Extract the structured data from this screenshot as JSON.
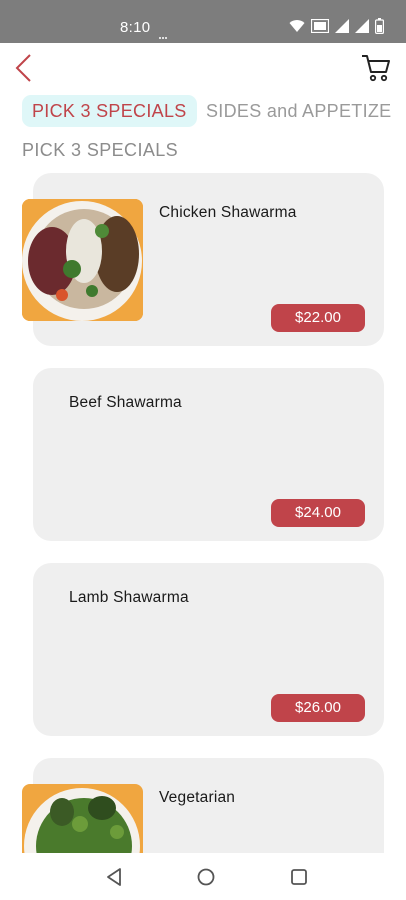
{
  "status_bar": {
    "time": "8:10",
    "icons": [
      "wifi-icon",
      "data-icon",
      "signal-icon",
      "signal-icon",
      "battery-icon"
    ]
  },
  "header": {
    "back_icon": "chevron-left-icon",
    "cart_icon": "cart-icon"
  },
  "tabs": [
    {
      "label": "PICK 3 SPECIALS",
      "active": true
    },
    {
      "label": "SIDES and APPETIZE",
      "active": false
    }
  ],
  "section_title": "PICK 3 SPECIALS",
  "menu_items": [
    {
      "name": "Chicken Shawarma",
      "price": "$22.00",
      "has_image": true
    },
    {
      "name": "Beef Shawarma",
      "price": "$24.00",
      "has_image": false
    },
    {
      "name": "Lamb Shawarma",
      "price": "$26.00",
      "has_image": false
    },
    {
      "name": "Vegetarian",
      "price": "",
      "has_image": true
    }
  ],
  "nav_bar": {
    "icons": [
      "back-triangle-icon",
      "home-circle-icon",
      "recents-square-icon"
    ]
  },
  "colors": {
    "accent": "#c0444a",
    "tab_active_bg": "#dff7f8",
    "card_bg": "#efefef",
    "status_bar_bg": "#7d7d7d"
  }
}
